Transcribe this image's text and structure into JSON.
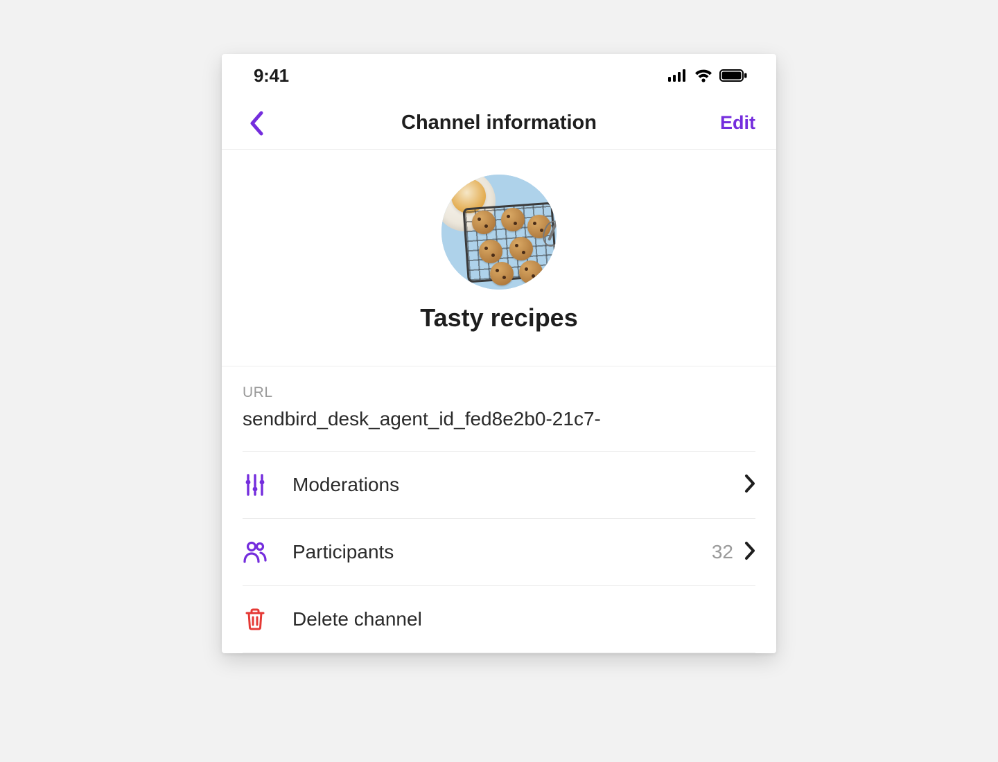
{
  "status": {
    "time": "9:41"
  },
  "nav": {
    "title": "Channel information",
    "edit": "Edit"
  },
  "channel": {
    "name": "Tasty recipes"
  },
  "url": {
    "label": "URL",
    "value": "sendbird_desk_agent_id_fed8e2b0-21c7-"
  },
  "rows": {
    "moderations": {
      "label": "Moderations"
    },
    "participants": {
      "label": "Participants",
      "count": "32"
    },
    "delete": {
      "label": "Delete channel"
    }
  },
  "colors": {
    "accent": "#742ddd",
    "danger": "#e53935",
    "textPrimary": "#1e1e1e",
    "textSecondary": "#9a9a9a",
    "divider": "#ececec"
  }
}
